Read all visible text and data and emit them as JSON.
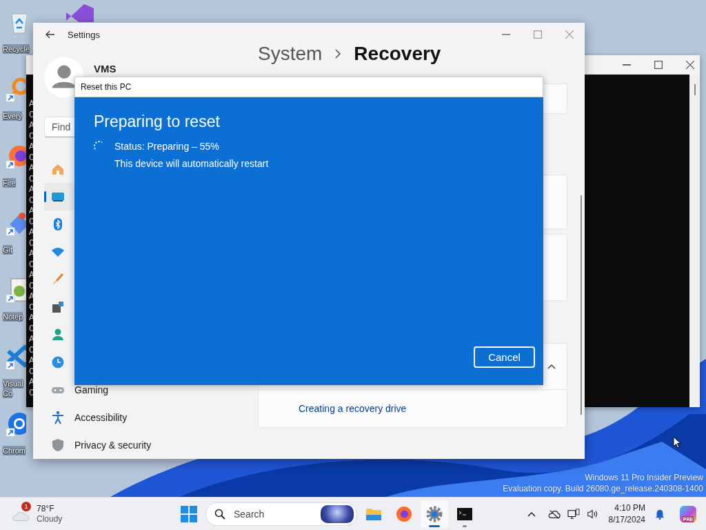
{
  "desktop": {
    "icons": [
      {
        "kind": "recycle",
        "lines": [
          "Recycle"
        ],
        "shortcut": false
      },
      {
        "kind": "everything",
        "lines": [
          "Every"
        ],
        "shortcut": true
      },
      {
        "kind": "firefox",
        "lines": [
          "Fire"
        ],
        "shortcut": true
      },
      {
        "kind": "git",
        "lines": [
          "Git"
        ],
        "shortcut": true
      },
      {
        "kind": "notepad",
        "lines": [
          "Notep"
        ],
        "shortcut": true
      },
      {
        "kind": "vscode",
        "lines": [
          "Visual",
          "Co"
        ],
        "shortcut": true
      },
      {
        "kind": "chrome",
        "lines": [
          "Chrom"
        ],
        "shortcut": true
      }
    ],
    "watermark": [
      "Windows 11 Pro Insider Preview",
      "Evaluation copy. Build 26080.ge_release.240308-1400"
    ]
  },
  "console": {
    "lines": [
      "A",
      "C",
      "A",
      "C",
      "A",
      "C",
      "A",
      "C",
      "A",
      "C",
      "A",
      "C",
      "A",
      "C",
      "A",
      "C",
      "A",
      "C",
      "A",
      "C",
      "A",
      "C",
      "A",
      "C",
      "A",
      "C",
      "A",
      "C"
    ]
  },
  "settings": {
    "title": "Settings",
    "user": "VMS",
    "breadcrumb": [
      "System",
      "Recovery"
    ],
    "search": {
      "placeholder": "Find"
    },
    "nav": [
      {
        "kind": "home",
        "selected": false
      },
      {
        "kind": "system",
        "selected": true
      },
      {
        "kind": "bluetooth",
        "selected": false
      },
      {
        "kind": "network",
        "selected": false
      },
      {
        "kind": "personalization",
        "selected": false
      },
      {
        "kind": "apps",
        "selected": false
      },
      {
        "kind": "accounts",
        "selected": false
      },
      {
        "kind": "time",
        "selected": false
      },
      {
        "kind": "gaming",
        "label": "Gaming",
        "selected": false
      },
      {
        "kind": "accessibility",
        "label": "Accessibility",
        "selected": false
      },
      {
        "kind": "privacy",
        "label": "Privacy & security",
        "selected": false
      }
    ],
    "recovery_link": "Creating a recovery drive"
  },
  "dialog": {
    "title": "Reset this PC",
    "heading": "Preparing to reset",
    "status": "Status: Preparing – 55%",
    "note": "This device will automatically restart",
    "button": "Cancel"
  },
  "taskbar": {
    "weather": {
      "badge": "1",
      "temperature": "78°F",
      "condition": "Cloudy"
    },
    "search": {
      "placeholder": "Search"
    },
    "apps": [
      {
        "kind": "explorer",
        "active": false,
        "running": false
      },
      {
        "kind": "firefox",
        "active": false,
        "running": false
      },
      {
        "kind": "settings",
        "active": true,
        "running": true
      },
      {
        "kind": "terminal",
        "active": false,
        "running": true
      }
    ],
    "time": "4:10 PM",
    "date": "8/17/2024",
    "copilot_badge": "PRE"
  }
}
